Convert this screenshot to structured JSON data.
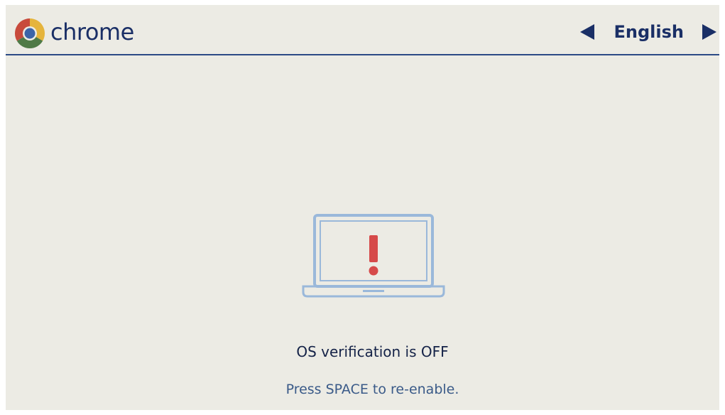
{
  "header": {
    "brand": "chrome",
    "language": "English"
  },
  "icons": {
    "logo": "chrome-logo-icon",
    "prev_language": "triangle-left-icon",
    "next_language": "triangle-right-icon",
    "illustration": "laptop-warning-icon"
  },
  "message": {
    "title": "OS verification is OFF",
    "instruction": "Press SPACE to re-enable."
  },
  "colors": {
    "background": "#ecebe4",
    "text_dark": "#1a2f66",
    "text_muted": "#3a5a88",
    "laptop_outline": "#9ab8da",
    "warning_red": "#d64a4a"
  }
}
